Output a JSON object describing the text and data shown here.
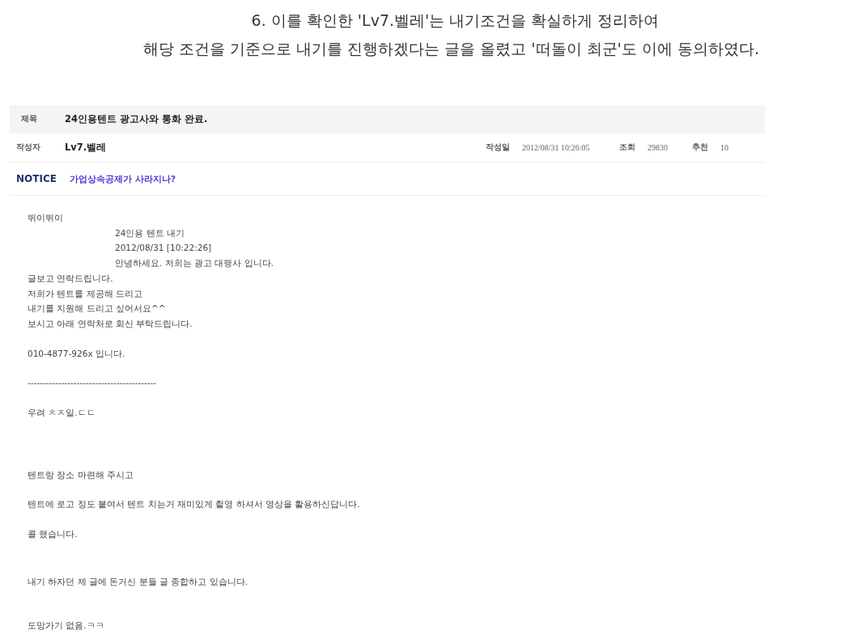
{
  "caption": [
    "6. 이를 확인한 'Lv7.벨레'는 내기조건을 확실하게 정리하여",
    "해당 조건을 기준으로 내기를 진행하겠다는 글을 올렸고 '떠돌이 최군'도 이에 동의하였다."
  ],
  "post": {
    "title_label": "제목",
    "title": "24인용텐트 광고사와 통화 완료.",
    "meta": [
      {
        "label": "작성자",
        "value": "Lv7.벨레"
      },
      {
        "label": "작성일",
        "value": "2012/08/31 10:26:05"
      },
      {
        "label": "조회",
        "value": "29830"
      },
      {
        "label": "추천",
        "value": "10"
      }
    ],
    "notice": {
      "badge": "NOTICE",
      "link": "가업상속공제가 사라지나?"
    },
    "body": [
      [
        {
          "text": "뛰이뛰이",
          "indented": false
        },
        {
          "text": "24인용 텐트 내기",
          "indented": true
        },
        {
          "text": "2012/08/31 [10:22:26]",
          "indented": true
        },
        {
          "text": "안녕하세요. 저희는 광고 대행사 입니다.",
          "indented": true
        },
        {
          "text": "글보고 연락드립니다.",
          "indented": false
        },
        {
          "text": "저희가 텐트를 제공해 드리고",
          "indented": false
        },
        {
          "text": "내기를 지원해 드리고 싶어서요^^",
          "indented": false
        },
        {
          "text": "보시고 아래 연락처로 회신 부탁드립니다.",
          "indented": false
        }
      ],
      [
        {
          "text": "010-4877-926x 입니다.",
          "indented": false
        }
      ],
      [
        {
          "text": "------------------------------------------",
          "indented": false
        }
      ],
      [
        {
          "text": "우려 ㅊㅈ일.ㄷㄷ",
          "indented": false
        }
      ],
      [
        {
          "text": "텐트랑 장소 마련해 주시고",
          "indented": false
        }
      ],
      [
        {
          "text": "텐트에 로고 정도 붙여서 텐트 치는거 재미있게 촬영 하셔서 영상을 활용하신답니다.",
          "indented": false
        }
      ],
      [
        {
          "text": "콜 했습니다.",
          "indented": false
        }
      ],
      [
        {
          "text": "내기 하자던 제 글에 돈거신 분들 글 종합하고 있습니다.",
          "indented": false
        }
      ],
      [
        {
          "text": "도망가기 없음.ㅋㅋ",
          "indented": false
        }
      ]
    ]
  }
}
